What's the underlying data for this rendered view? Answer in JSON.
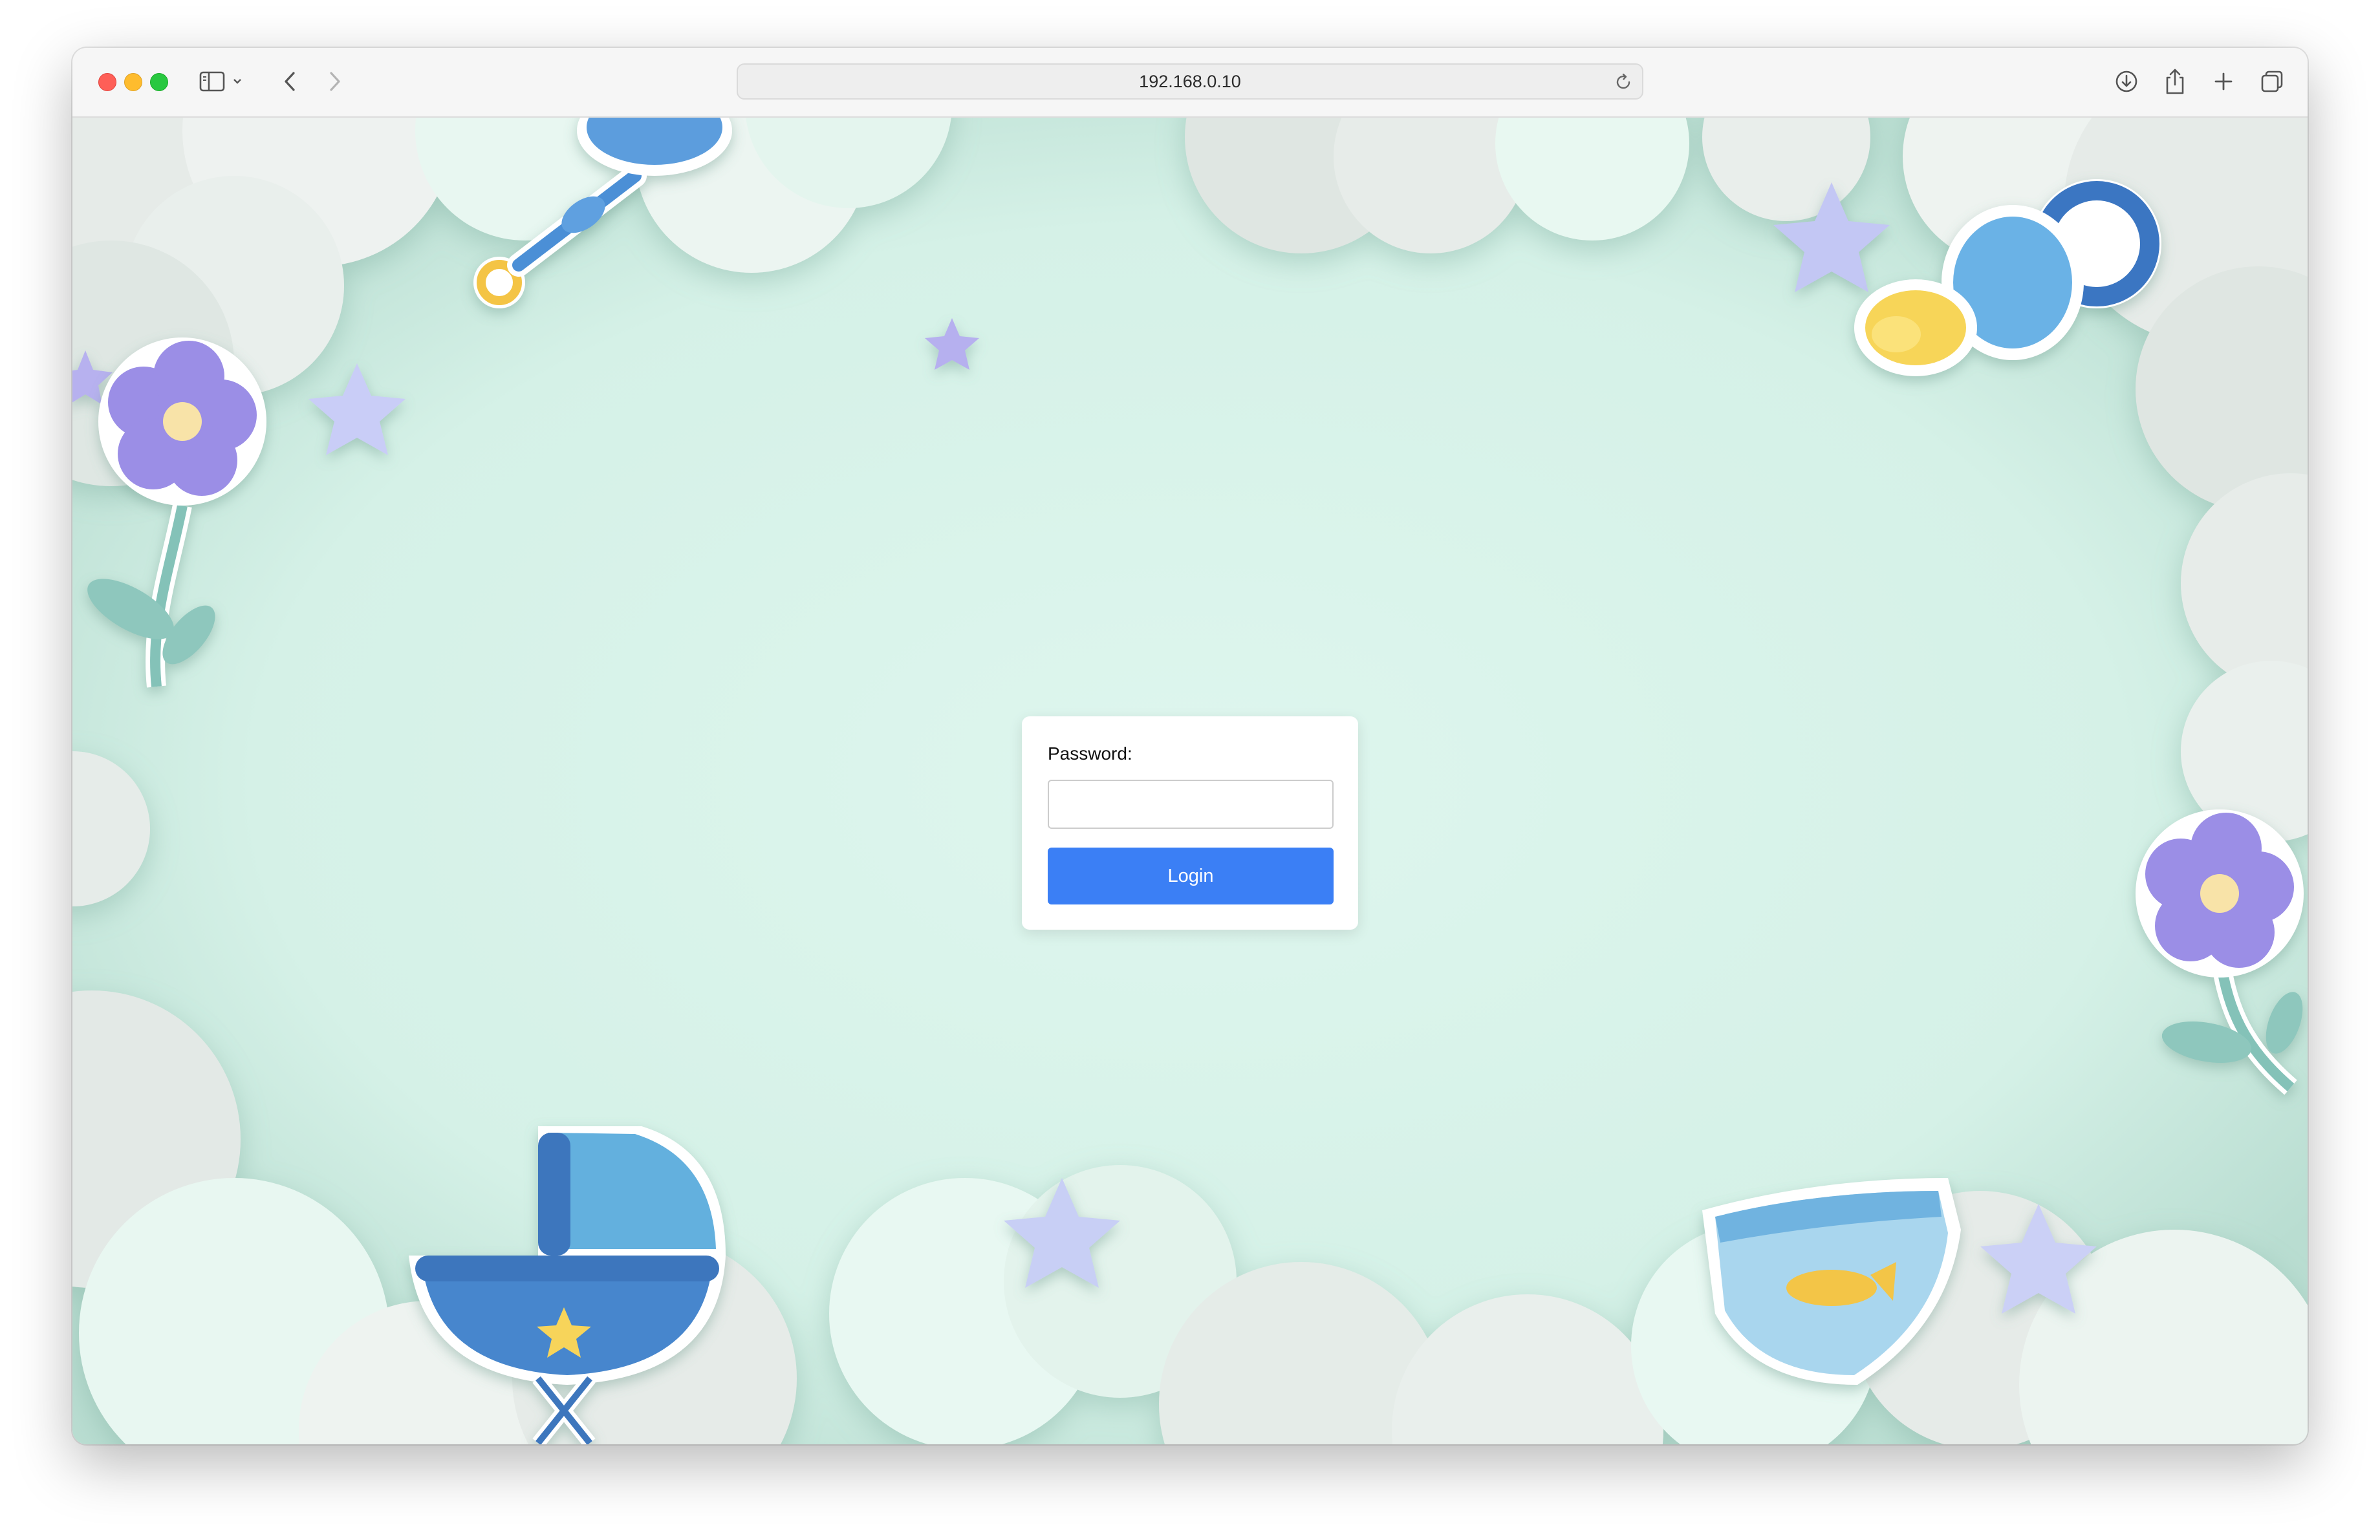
{
  "browser": {
    "address": "192.168.0.10",
    "icons": {
      "sidebar": "sidebar-icon",
      "chevron": "chevron-down-icon",
      "back": "back-arrow-icon",
      "forward": "forward-arrow-icon",
      "reload": "reload-icon",
      "download": "download-icon",
      "share": "share-icon",
      "new_tab": "plus-icon",
      "tabs": "tab-overview-icon"
    }
  },
  "login": {
    "password_label": "Password:",
    "password_value": "",
    "password_placeholder": "",
    "button_label": "Login"
  },
  "colors": {
    "background": "#d8f3ea",
    "button": "#3b7ff5",
    "card": "#ffffff"
  }
}
